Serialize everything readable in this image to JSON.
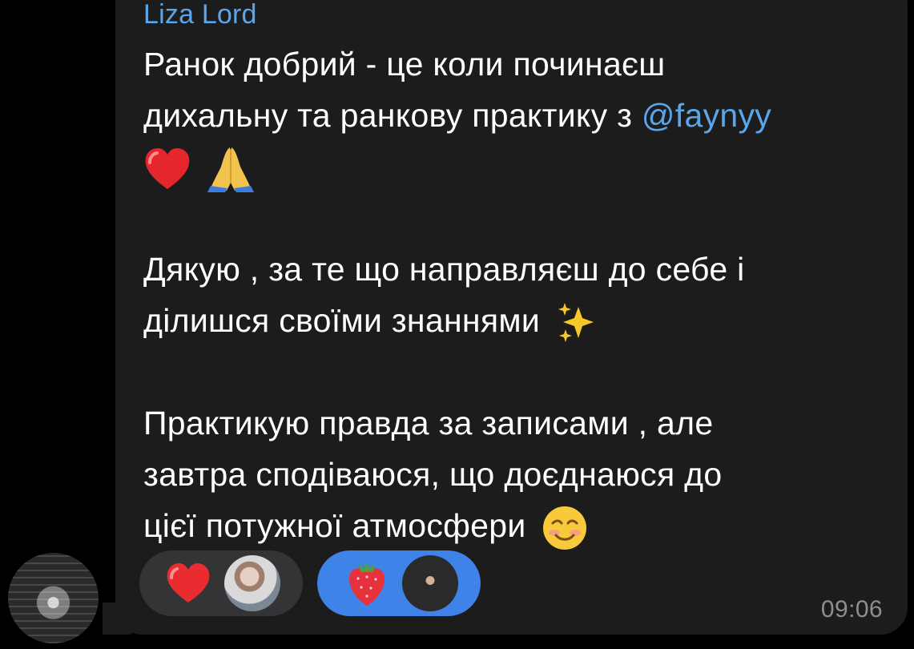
{
  "message": {
    "sender": "Liza Lord",
    "lines": [
      "Ранок добрий  - це коли починаєш",
      "дихальну та ранкову практику з",
      "",
      "Дякую , за те що направляєш до себе і",
      "ділишся своїми знаннями",
      "Практикую правда за записами , але",
      "завтра сподіваюся, що доєднаюся до",
      "цієї потужної атмосфери"
    ],
    "mention": "@faynyy",
    "time": "09:06",
    "reactions": [
      {
        "emoji": "heart-icon",
        "count_avatar": "reaction-user-avatar"
      },
      {
        "emoji": "strawberry-icon",
        "count_avatar": "reaction-user-avatar"
      }
    ]
  },
  "colors": {
    "background": "#000000",
    "bubble": "#1c1c1d",
    "mention": "#5aa6ea",
    "time": "#8e8e93",
    "reaction_selected": "#3f82e8",
    "reaction_default": "#343436"
  }
}
